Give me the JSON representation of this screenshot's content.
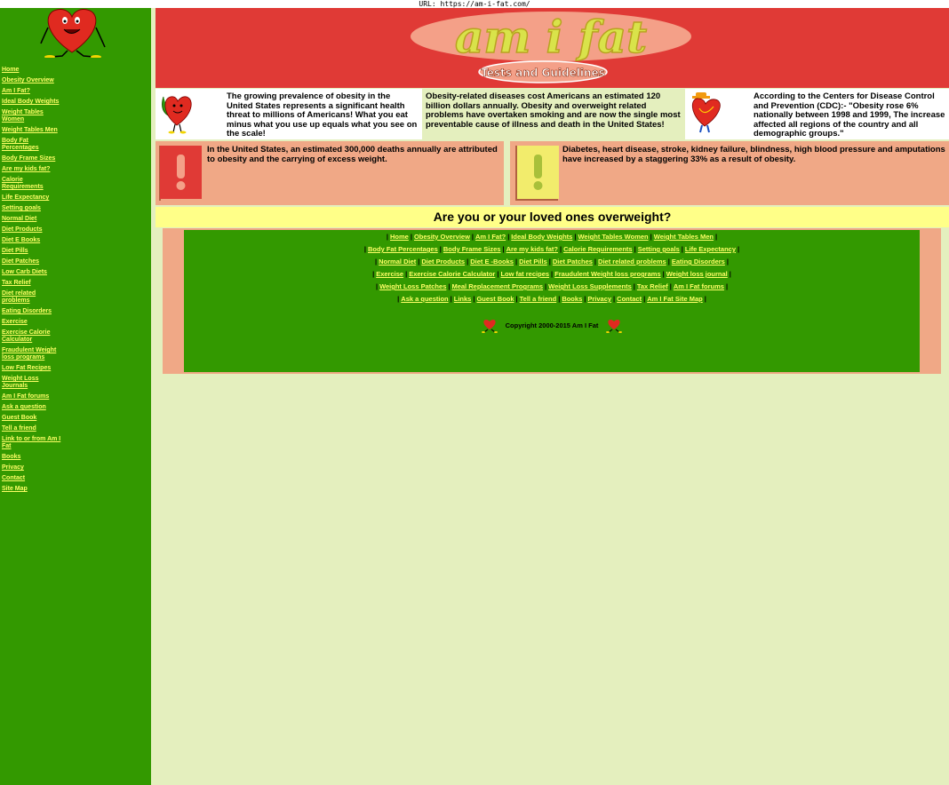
{
  "url_label": "URL: https://am-i-fat.com/",
  "sidebar": {
    "items": [
      {
        "label": "Home"
      },
      {
        "label": "Obesity Overview"
      },
      {
        "label": "Am I Fat?"
      },
      {
        "label": "Ideal Body Weights"
      },
      {
        "label": "Weight Tables Women"
      },
      {
        "label": "Weight Tables Men"
      },
      {
        "label": "Body Fat Percentages"
      },
      {
        "label": "Body Frame Sizes"
      },
      {
        "label": "Are my kids fat?"
      },
      {
        "label": "Calorie Requirements"
      },
      {
        "label": "Life Expectancy"
      },
      {
        "label": "Setting goals"
      },
      {
        "label": "Normal Diet"
      },
      {
        "label": "Diet Products"
      },
      {
        "label": "Diet E Books"
      },
      {
        "label": "Diet Pills"
      },
      {
        "label": "Diet Patches"
      },
      {
        "label": "Low Carb Diets"
      },
      {
        "label": "Tax Relief"
      },
      {
        "label": "Diet related problems"
      },
      {
        "label": "Eating Disorders"
      },
      {
        "label": "Exercise"
      },
      {
        "label": "Exercise Calorie Calculator"
      },
      {
        "label": "Fraudulent Weight loss programs"
      },
      {
        "label": "Low Fat Recipes"
      },
      {
        "label": "Weight Loss Journals"
      },
      {
        "label": "Am I Fat forums"
      },
      {
        "label": "Ask a question"
      },
      {
        "label": "Guest Book"
      },
      {
        "label": "Tell a friend"
      },
      {
        "label": "Link to or from Am I Fat"
      },
      {
        "label": "Books"
      },
      {
        "label": "Privacy"
      },
      {
        "label": "Contact"
      },
      {
        "label": "Site Map"
      }
    ]
  },
  "banner": {
    "title": "am i fat",
    "subtitle": "Tests and Guidelines"
  },
  "facts": {
    "fact1": "The growing prevalence of obesity in the United States represents a significant health threat to millions of Americans! What you eat minus what you use up equals what you see on the scale!",
    "fact2": "Obesity-related diseases cost Americans an estimated 120 billion dollars annually. Obesity and overweight related problems have overtaken smoking and are now the single most preventable cause of illness and death in the United States!",
    "fact3": "According to the Centers for Disease Control and Prevention (CDC):- \"Obesity rose 6% nationally between 1998 and 1999, The increase affected all regions of the country and all demographic groups.\""
  },
  "alerts": {
    "alert1": "In the United States, an estimated 300,000 deaths annually are attributed to obesity and the carrying of excess weight.",
    "alert2": "Diabetes, heart disease, stroke, kidney failure, blindness, high blood pressure and amputations have increased by a staggering 33% as a result of obesity."
  },
  "question": "Are you or your loved ones overweight?",
  "footer": {
    "rows": [
      [
        "Home",
        "Obesity Overview",
        "Am I Fat?",
        "Ideal Body Weights",
        "Weight Tables Women",
        "Weight Tables Men"
      ],
      [
        "Body Fat Percentages",
        "Body Frame Sizes",
        "Are my kids fat?",
        "Calorie Requirements",
        "Setting goals",
        "Life Expectancy"
      ],
      [
        "Normal Diet",
        "Diet Products",
        "Diet E -Books",
        "Diet Pills",
        "Diet Patches",
        "Diet related problems",
        "Eating Disorders"
      ],
      [
        "Exercise",
        "Exercise Calorie Calculator",
        "Low fat recipes",
        "Fraudulent Weight loss programs",
        "Weight loss journal"
      ],
      [
        "Weight Loss Patches",
        "Meal Replacement Programs",
        "Weight Loss Supplements",
        "Tax Relief",
        "Am I Fat forums"
      ],
      [
        "Ask a question",
        "Links",
        "Guest Book",
        "Tell a friend",
        "Books",
        "Privacy",
        "Contact",
        "Am I Fat Site Map"
      ]
    ],
    "copyright": "Copyright 2000-2015 Am I Fat"
  },
  "colors": {
    "sidebar": "#339900",
    "link": "#ffff66",
    "banner": "#e03a36",
    "salmon": "#f0a886",
    "question_bar": "#ffff88",
    "page_bg": "#e4efbe"
  },
  "icons": [
    "heart-mascot-icon",
    "exclamation-icon",
    "heart-mascot-hat-icon"
  ]
}
